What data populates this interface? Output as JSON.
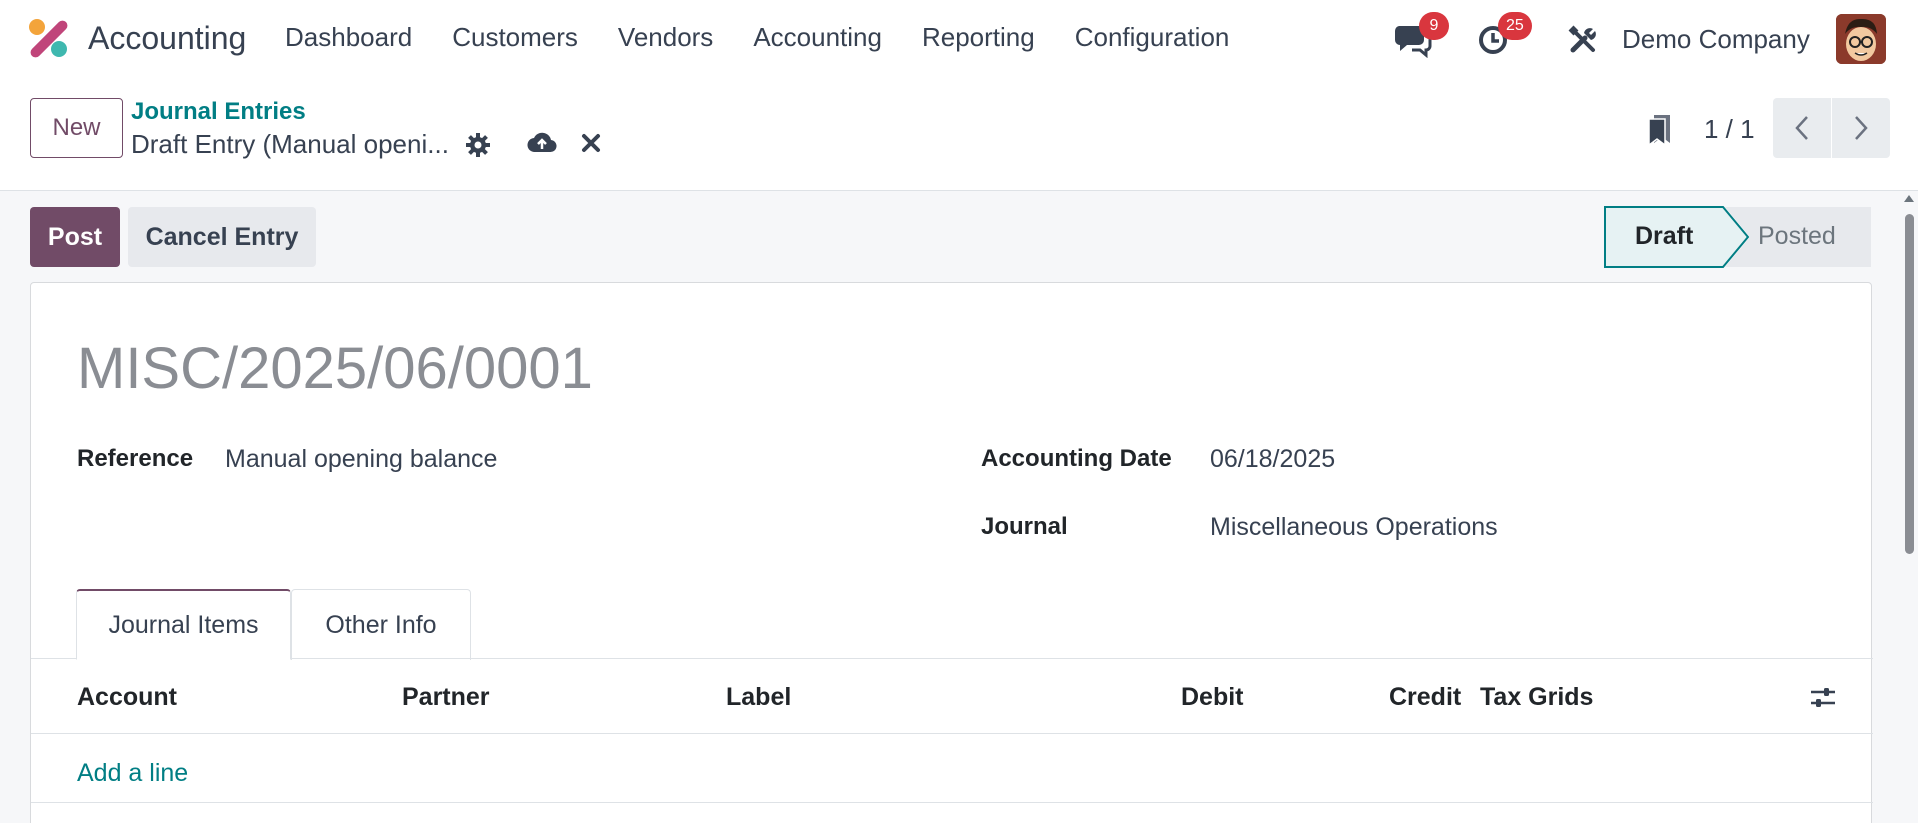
{
  "navbar": {
    "app_name": "Accounting",
    "menu": [
      "Dashboard",
      "Customers",
      "Vendors",
      "Accounting",
      "Reporting",
      "Configuration"
    ],
    "messages_badge": "9",
    "activities_badge": "25",
    "company": "Demo Company",
    "icons": [
      "app-logo-icon",
      "chat-icon",
      "clock-icon",
      "tools-icon"
    ]
  },
  "control_panel": {
    "new_label": "New",
    "breadcrumb": "Journal Entries",
    "record_name": "Draft Entry (Manual openi...",
    "pager": "1 / 1",
    "icons": [
      "gear-icon",
      "cloud-upload-icon",
      "close-icon",
      "bookmark-icon",
      "chevron-left-icon",
      "chevron-right-icon"
    ]
  },
  "actions": {
    "post_label": "Post",
    "cancel_label": "Cancel Entry"
  },
  "status": {
    "steps": [
      "Draft",
      "Posted"
    ],
    "current": "Draft"
  },
  "form": {
    "name": "MISC/2025/06/0001",
    "reference_label": "Reference",
    "reference_value": "Manual opening balance",
    "date_label": "Accounting Date",
    "date_value": "06/18/2025",
    "journal_label": "Journal",
    "journal_value": "Miscellaneous Operations"
  },
  "tabs": [
    "Journal Items",
    "Other Info"
  ],
  "table": {
    "columns": [
      "Account",
      "Partner",
      "Label",
      "Debit",
      "Credit",
      "Tax Grids"
    ],
    "add_line": "Add a line"
  },
  "colors": {
    "primary": "#714b67",
    "link": "#017e84",
    "badge": "#d9363e"
  }
}
